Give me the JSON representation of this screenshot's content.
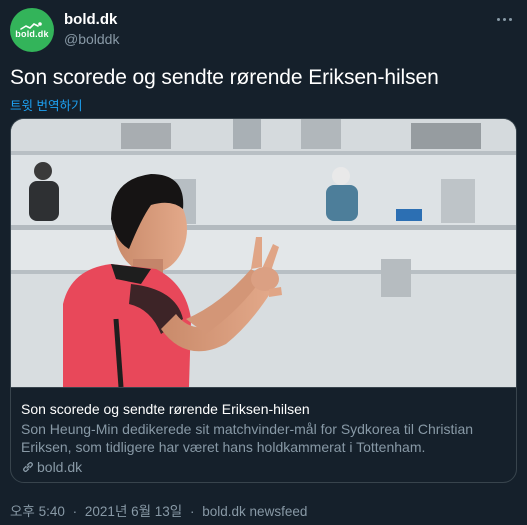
{
  "account": {
    "avatar_text": "bold.dk",
    "name": "bold.dk",
    "handle": "@bolddk"
  },
  "tweet": {
    "text": "Son scorede og sendte rørende Eriksen-hilsen",
    "translate_label": "트윗 번역하기"
  },
  "card": {
    "title": "Son scorede og sendte rørende Eriksen-hilsen",
    "description": "Son Heung-Min dedikerede sit matchvinder-mål for Sydkorea til Christian Eriksen, som tidligere har været hans holdkammerat i Tottenham.",
    "domain": "bold.dk"
  },
  "meta": {
    "time": "오후 5:40",
    "date": "2021년 6월 13일",
    "separator": "·",
    "source": "bold.dk newsfeed"
  },
  "colors": {
    "background": "#15202b",
    "accent": "#1da1f2",
    "muted": "#8899a6",
    "brand": "#33b45a",
    "jersey": "#e8485a"
  },
  "icons": {
    "more": "more-icon",
    "link": "link-icon"
  }
}
